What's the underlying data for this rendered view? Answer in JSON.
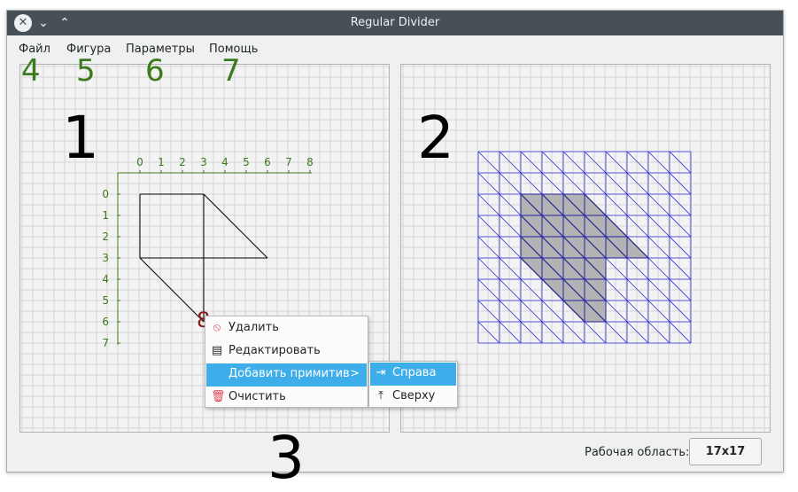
{
  "window": {
    "title": "Regular Divider"
  },
  "menu": {
    "items": [
      "Файл",
      "Фигура",
      "Параметры",
      "Помощь"
    ]
  },
  "annotations": {
    "n1": "1",
    "n2": "2",
    "n3": "3",
    "n4": "4",
    "n5": "5",
    "n6": "6",
    "n7": "7",
    "n8": "8"
  },
  "editor": {
    "x_ticks": [
      "0",
      "1",
      "2",
      "3",
      "4",
      "5",
      "6",
      "7",
      "8"
    ],
    "y_ticks": [
      "0",
      "1",
      "2",
      "3",
      "4",
      "5",
      "6",
      "7"
    ],
    "axis_color": "#3c7a1e"
  },
  "context_menu": {
    "items": [
      {
        "label": "Удалить",
        "icon": "forbidden-icon"
      },
      {
        "label": "Редактировать",
        "icon": "edit-list-icon"
      },
      {
        "label": "Добавить примитив",
        "icon": "",
        "submenu_arrow": ">"
      },
      {
        "label": "Очистить",
        "icon": "trash-icon"
      }
    ],
    "submenu": [
      {
        "label": "Справа",
        "icon": "align-right-icon"
      },
      {
        "label": "Сверху",
        "icon": "align-top-icon"
      }
    ]
  },
  "status": {
    "work_area_label": "Рабочая область:",
    "work_area_value": "17x17"
  },
  "colors": {
    "accent": "#3daee9",
    "grid_blue": "#2b2bd6",
    "fill_gray": "#b3b3b3",
    "annotation_red": "#8b1a1a"
  }
}
